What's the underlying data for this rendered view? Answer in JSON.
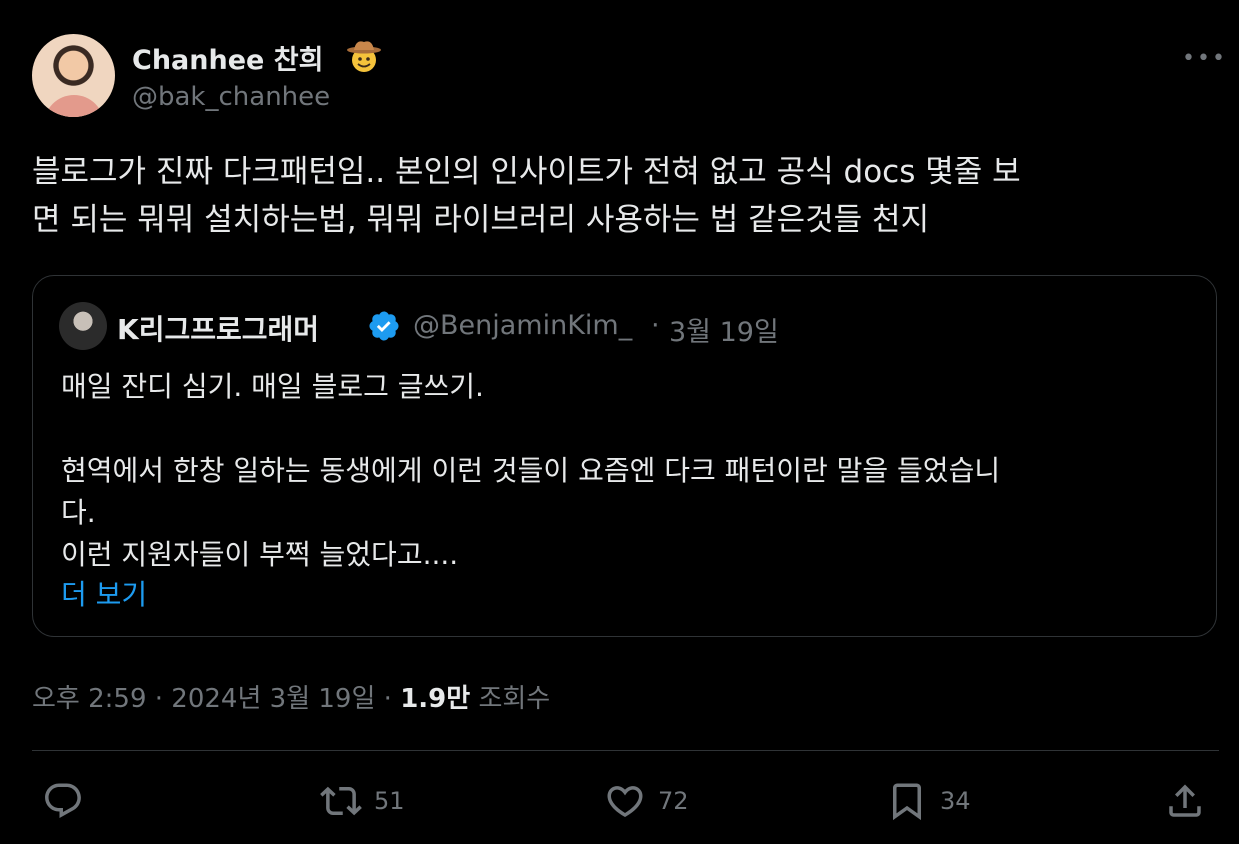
{
  "author": {
    "display_name": "Chanhee 찬희",
    "handle": "@bak_chanhee",
    "emoji": "cowboy-face-icon"
  },
  "tweet": {
    "text": "블로그가 진짜 다크패턴임.. 본인의 인사이트가 전혀 없고 공식 docs 몇줄 보\n면 되는 뭐뭐 설치하는법, 뭐뭐 라이브러리 사용하는 법 같은것들 천지"
  },
  "quote": {
    "display_name": "K리그프로그래머",
    "handle": "@BenjaminKim_",
    "separator": "·",
    "date": "3월 19일",
    "text": "매일 잔디 심기. 매일 블로그 글쓰기.\n\n현역에서 한창 일하는 동생에게 이런 것들이 요즘엔 다크 패턴이란 말을 들었습니\n다.\n이런 지원자들이 부쩍 늘었다고....",
    "more_label": "더 보기"
  },
  "meta": {
    "time": "오후 2:59",
    "dot1": "·",
    "date": "2024년 3월 19일",
    "dot2": "·",
    "views": "1.9만",
    "views_label": "조회수"
  },
  "actions": {
    "reply_count": "",
    "retweet_count": "51",
    "like_count": "72",
    "bookmark_count": "34"
  },
  "colors": {
    "background": "#000000",
    "text": "#e7e9ea",
    "muted": "#71767b",
    "link": "#1d9bf0",
    "border": "#2f3336"
  }
}
